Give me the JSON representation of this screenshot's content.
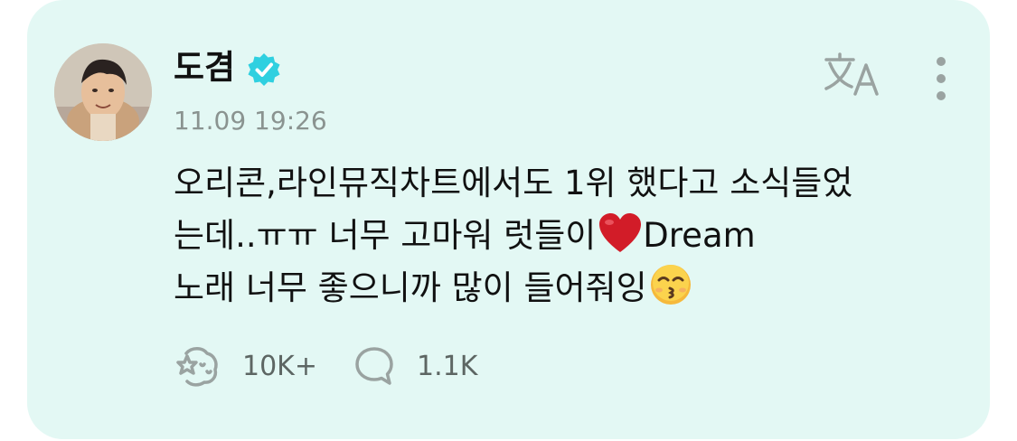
{
  "post": {
    "author": "도겸",
    "verified": true,
    "timestamp": "11.09 19:26",
    "lines": [
      "오리콘,라인뮤직차트에서도 1위 했다고 소식들었",
      "는데..ㅠㅠ 너무 고마워 럿들이",
      "Dream",
      "노래 너무 좋으니까 많이 들어줘잉"
    ],
    "emojis": [
      "red-heart",
      "kissing-smiling-eyes"
    ]
  },
  "actions": {
    "likes": "10K+",
    "comments": "1.1K"
  },
  "icons": {
    "verified": "verified-badge-icon",
    "translate": "translate-icon",
    "more": "more-vertical-icon",
    "like": "like-icon",
    "comment": "comment-icon"
  },
  "colors": {
    "card_background": "#e3f8f4",
    "verified": "#2fd0e0",
    "icon_gray": "#9aa3a1",
    "heart": "#d21c28",
    "emoji_face": "#f6b93b"
  }
}
